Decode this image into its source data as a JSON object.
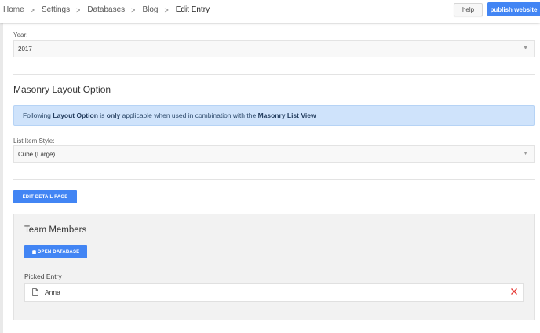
{
  "breadcrumb": {
    "items": [
      "Home",
      "Settings",
      "Databases",
      "Blog",
      "Edit Entry"
    ],
    "separator": ">"
  },
  "toolbar": {
    "help_label": "help",
    "publish_label": "publish website"
  },
  "year_field": {
    "label": "Year:",
    "value": "2017"
  },
  "masonry": {
    "title": "Masonry Layout Option",
    "info": {
      "t1": "Following ",
      "b1": "Layout Option",
      "t2": " is ",
      "b2": "only",
      "t3": " applicable when used in combination with the ",
      "b3": "Masonry List View"
    },
    "list_style": {
      "label": "List Item Style:",
      "value": "Cube (Large)"
    }
  },
  "edit_detail_label": "EDIT DETAIL PAGE",
  "team": {
    "title": "Team Members",
    "open_db_label": "OPEN DATABASE",
    "picked_label": "Picked Entry",
    "entry_name": "Anna"
  },
  "colors": {
    "accent": "#4285f4",
    "info_bg": "#cfe3fb",
    "delete": "#e53935"
  },
  "icons": {
    "select_caret": "▼",
    "breadcrumb_separator": "chevron-right-icon",
    "open_db": "database-icon",
    "entry": "document-icon",
    "remove": "close-icon"
  }
}
